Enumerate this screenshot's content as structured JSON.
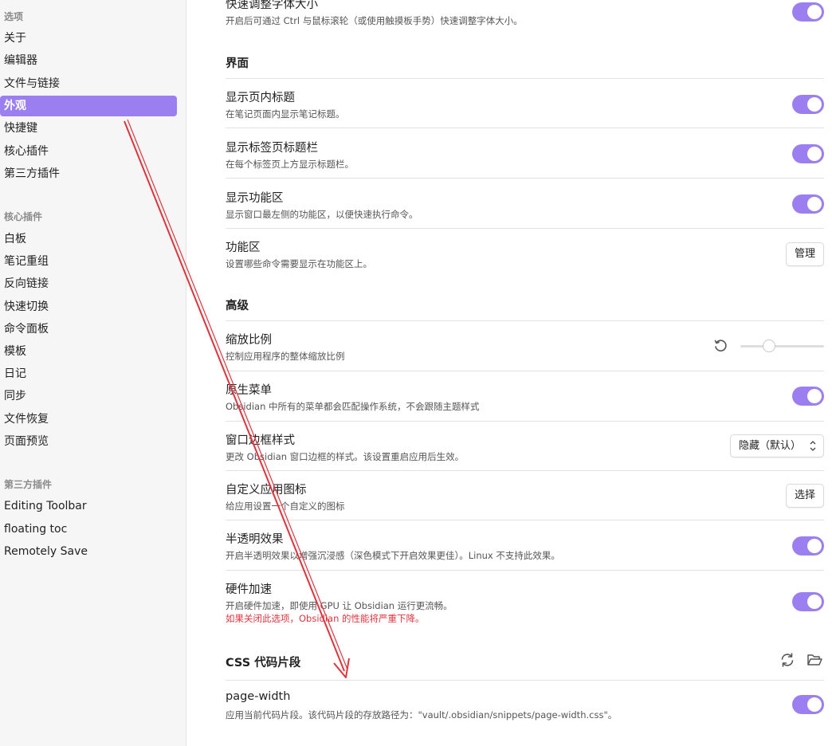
{
  "sidebar": {
    "options_header": "选项",
    "options": [
      {
        "label": "关于",
        "active": false
      },
      {
        "label": "编辑器",
        "active": false
      },
      {
        "label": "文件与链接",
        "active": false
      },
      {
        "label": "外观",
        "active": true
      },
      {
        "label": "快捷键",
        "active": false
      },
      {
        "label": "核心插件",
        "active": false
      },
      {
        "label": "第三方插件",
        "active": false
      }
    ],
    "core_header": "核心插件",
    "core": [
      "白板",
      "笔记重组",
      "反向链接",
      "快速切换",
      "命令面板",
      "模板",
      "日记",
      "同步",
      "文件恢复",
      "页面预览"
    ],
    "third_header": "第三方插件",
    "third": [
      "Editing Toolbar",
      "floating toc",
      "Remotely Save"
    ]
  },
  "main": {
    "font_resize": {
      "title": "快速调整字体大小",
      "desc": "开启后可通过 Ctrl 与鼠标滚轮（或使用触摸板手势）快速调整字体大小。",
      "enabled": true
    },
    "interface_section": "界面",
    "show_inline_title": {
      "title": "显示页内标题",
      "desc": "在笔记页面内显示笔记标题。",
      "enabled": true
    },
    "show_tab_title_bar": {
      "title": "显示标签页标题栏",
      "desc": "在每个标签页上方显示标题栏。",
      "enabled": true
    },
    "show_ribbon": {
      "title": "显示功能区",
      "desc": "显示窗口最左侧的功能区，以便快速执行命令。",
      "enabled": true
    },
    "ribbon": {
      "title": "功能区",
      "desc": "设置哪些命令需要显示在功能区上。",
      "button": "管理"
    },
    "advanced_section": "高级",
    "zoom": {
      "title": "缩放比例",
      "desc": "控制应用程序的整体缩放比例",
      "value": 0.32
    },
    "native_menus": {
      "title": "原生菜单",
      "desc": "Obsidian 中所有的菜单都会匹配操作系统，不会跟随主题样式",
      "enabled": true
    },
    "frame_style": {
      "title": "窗口边框样式",
      "desc": "更改 Obsidian 窗口边框的样式。该设置重启应用后生效。",
      "selected": "隐藏（默认）"
    },
    "app_icon": {
      "title": "自定义应用图标",
      "desc": "给应用设置一个自定义的图标",
      "button": "选择"
    },
    "translucent": {
      "title": "半透明效果",
      "desc": "开启半透明效果以增强沉浸感（深色模式下开启效果更佳）。Linux 不支持此效果。",
      "enabled": true
    },
    "hw_accel": {
      "title": "硬件加速",
      "desc": "开启硬件加速，即使用 GPU 让 Obsidian 运行更流畅。",
      "warning": "如果关闭此选项，Obsidian 的性能将严重下降。",
      "enabled": true
    },
    "css_section": "CSS 代码片段",
    "snippet": {
      "title": "page-width",
      "desc": "应用当前代码片段。该代码片段的存放路径为：\"vault/.obsidian/snippets/page-width.css\"。",
      "enabled": true
    }
  },
  "colors": {
    "accent": "#9b7ff0",
    "annotation": "#e0343d",
    "warning": "#e0343d"
  }
}
